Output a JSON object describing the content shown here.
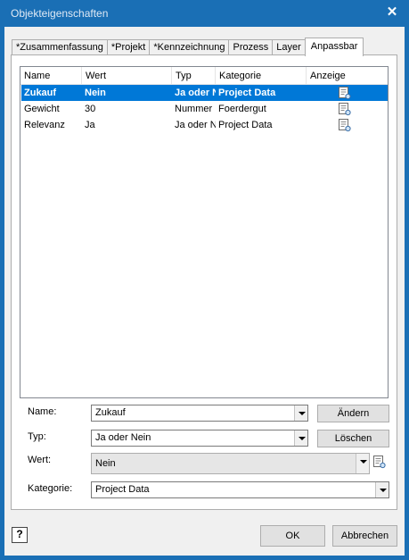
{
  "window": {
    "title": "Objekteigenschaften",
    "close_glyph": "✕"
  },
  "tabs": [
    {
      "label": "*Zusammenfassung",
      "active": false
    },
    {
      "label": "*Projekt",
      "active": false
    },
    {
      "label": "*Kennzeichnung",
      "active": false
    },
    {
      "label": "Prozess",
      "active": false
    },
    {
      "label": "Layer",
      "active": false
    },
    {
      "label": "Anpassbar",
      "active": true
    }
  ],
  "list": {
    "columns": [
      "Name",
      "Wert",
      "Typ",
      "Kategorie",
      "Anzeige"
    ],
    "rows": [
      {
        "name": "Zukauf",
        "wert": "Nein",
        "typ": "Ja oder N",
        "kategorie": "Project Data",
        "anzeige_icon": "document-display-icon",
        "selected": true
      },
      {
        "name": "Gewicht",
        "wert": "30",
        "typ": "Nummer",
        "kategorie": "Foerdergut",
        "anzeige_icon": "document-display-icon",
        "selected": false
      },
      {
        "name": "Relevanz",
        "wert": "Ja",
        "typ": "Ja oder N",
        "kategorie": "Project Data",
        "anzeige_icon": "document-display-icon",
        "selected": false
      }
    ]
  },
  "form": {
    "name_label": "Name:",
    "name_value": "Zukauf",
    "typ_label": "Typ:",
    "typ_value": "Ja oder Nein",
    "wert_label": "Wert:",
    "wert_value": "Nein",
    "kategorie_label": "Kategorie:",
    "kategorie_value": "Project Data",
    "aendern_label": "Ändern",
    "loeschen_label": "Löschen"
  },
  "footer": {
    "help_glyph": "?",
    "ok_label": "OK",
    "cancel_label": "Abbrechen"
  },
  "colors": {
    "titlebar": "#1a6fb5",
    "selection": "#0078d7",
    "dialog_bg": "#f0f0f0"
  }
}
